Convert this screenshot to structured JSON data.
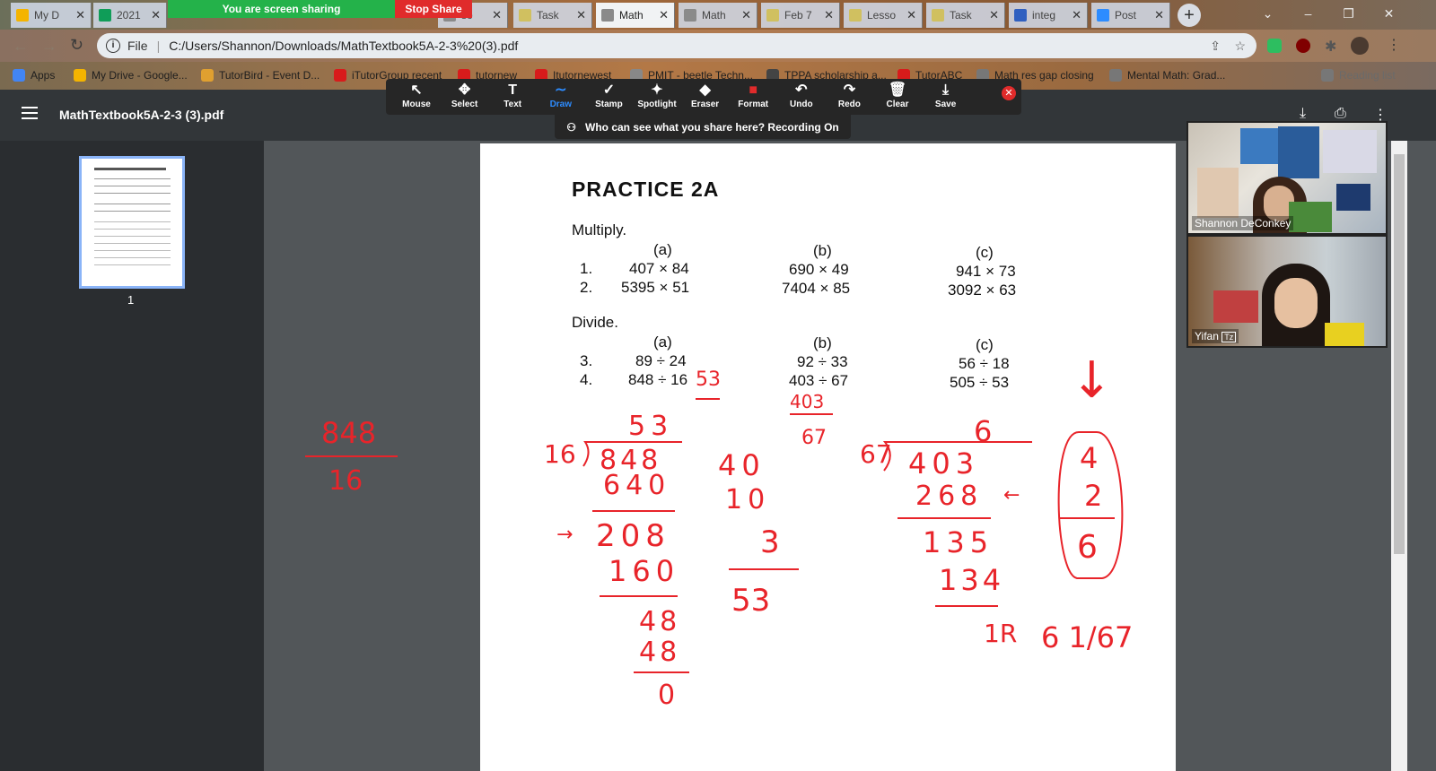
{
  "tabs": [
    {
      "label": "My D",
      "color": "#f4b400",
      "active": false
    },
    {
      "label": "2021",
      "color": "#0f9d58",
      "active": false
    },
    {
      "label": "so",
      "color": "#8a8a8a",
      "active": false
    },
    {
      "label": "Task",
      "color": "#d0c060",
      "active": false
    },
    {
      "label": "Math",
      "color": "#8a8a8a",
      "active": true
    },
    {
      "label": "Math",
      "color": "#8a8a8a",
      "active": false
    },
    {
      "label": "Feb 7",
      "color": "#d0c060",
      "active": false
    },
    {
      "label": "Lesso",
      "color": "#d0c060",
      "active": false
    },
    {
      "label": "Task",
      "color": "#d0c060",
      "active": false
    },
    {
      "label": "integ",
      "color": "#3060c0",
      "active": false
    },
    {
      "label": "Post",
      "color": "#2d8cff",
      "active": false
    }
  ],
  "sharing": {
    "label": "You are screen sharing",
    "stop": "Stop Share"
  },
  "omnibox": {
    "scheme": "File",
    "url": "C:/Users/Shannon/Downloads/MathTextbook5A-2-3%20(3).pdf"
  },
  "bookmarks": [
    {
      "label": "Apps",
      "color": "#4285f4"
    },
    {
      "label": "My Drive - Google...",
      "color": "#f4b400"
    },
    {
      "label": "TutorBird - Event D...",
      "color": "#e0a030"
    },
    {
      "label": "iTutorGroup recent",
      "color": "#d81b1b"
    },
    {
      "label": "tutornew",
      "color": "#d81b1b"
    },
    {
      "label": "Itutornewest",
      "color": "#d81b1b"
    },
    {
      "label": "PMIT - beetle Techn...",
      "color": "#888"
    },
    {
      "label": "TPPA scholarship a...",
      "color": "#444"
    },
    {
      "label": "TutorABC",
      "color": "#d81b1b"
    },
    {
      "label": "Math res gap closing",
      "color": "#777"
    },
    {
      "label": "Mental Math: Grad...",
      "color": "#777"
    },
    {
      "label": "Reading list",
      "color": "#777"
    }
  ],
  "pdf": {
    "filename": "MathTextbook5A-2-3 (3).pdf",
    "thumb_page": "1"
  },
  "annotate_tools": [
    {
      "label": "Mouse",
      "icon": "↖"
    },
    {
      "label": "Select",
      "icon": "✥"
    },
    {
      "label": "Text",
      "icon": "T"
    },
    {
      "label": "Draw",
      "icon": "∼"
    },
    {
      "label": "Stamp",
      "icon": "✓"
    },
    {
      "label": "Spotlight",
      "icon": "✦"
    },
    {
      "label": "Eraser",
      "icon": "◆"
    },
    {
      "label": "Format",
      "icon": "■"
    },
    {
      "label": "Undo",
      "icon": "↶"
    },
    {
      "label": "Redo",
      "icon": "↷"
    },
    {
      "label": "Clear",
      "icon": "🗑"
    },
    {
      "label": "Save",
      "icon": "⤓"
    }
  ],
  "recording_notice": "Who can see what you share here? Recording On",
  "worksheet": {
    "title": "PRACTICE 2A",
    "multiply_label": "Multiply.",
    "divide_label": "Divide.",
    "col_a": "(a)",
    "col_b": "(b)",
    "col_c": "(c)",
    "q1": {
      "num": "1.",
      "a": "407 × 84",
      "b": "690 × 49",
      "c": "941 × 73"
    },
    "q2": {
      "num": "2.",
      "a": "5395 × 51",
      "b": "7404 × 85",
      "c": "3092 × 63"
    },
    "q3": {
      "num": "3.",
      "a": "89 ÷ 24",
      "b": "92 ÷ 33",
      "c": "56 ÷ 18"
    },
    "q4": {
      "num": "4.",
      "a": "848 ÷ 16",
      "b": "403 ÷ 67",
      "c": "505 ÷ 53"
    }
  },
  "handwriting": {
    "side_num": "848",
    "side_den": "16",
    "ans_53": "53",
    "frac_403": "403",
    "frac_67": "67",
    "ld1_quot": "53",
    "ld1_div": "16",
    "ld1_dvd": "848",
    "ld1_s1": "640",
    "ld1_arrow": "→",
    "ld1_r1": "208",
    "ld1_s2": "160",
    "ld1_r2": "48",
    "ld1_s3": "48",
    "ld1_r3": "0",
    "mid_40": "40",
    "mid_10": "10",
    "mid_3": "3",
    "mid_53": "53",
    "ld2_quot": "6",
    "ld2_div": "67",
    "ld2_dvd": "403",
    "ld2_s1": "268",
    "ld2_arrow": "←",
    "ld2_r1": "135",
    "ld2_s2": "134",
    "ld2_rem": "1R",
    "ld2_ans": "6 1/67",
    "box_down": "↓",
    "box_4": "4",
    "box_2": "2",
    "box_6": "6"
  },
  "participants": [
    {
      "name": "Shannon DeConkey"
    },
    {
      "name": "Yifan"
    }
  ]
}
